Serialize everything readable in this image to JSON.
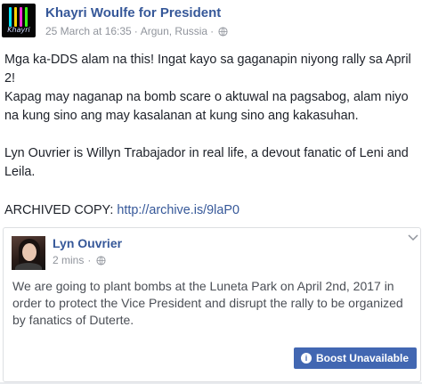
{
  "post": {
    "page_name": "Khayri Woulfe for President",
    "avatar_text": "Khayri",
    "avatar_colors": [
      "#00e5ff",
      "#ffd400",
      "#ff2bd6",
      "#39ff14"
    ],
    "timestamp": "25 March at 16:35",
    "separator": "·",
    "location": "Argun, Russia",
    "dot": "·",
    "paragraphs": [
      "Mga ka-DDS alam na this! Ingat kayo sa gaganapin niyong rally sa April 2!",
      "Kapag may naganap na bomb scare o aktuwal na pagsabog, alam niyo na kung sino ang may kasalanan at kung sino ang kakasuhan.",
      "Lyn Ouvrier is Willyn Trabajador in real life, a devout fanatic of Leni and Leila."
    ],
    "archived_label": "ARCHIVED COPY: ",
    "archived_link": "http://archive.is/9laP0"
  },
  "shared": {
    "name": "Lyn Ouvrier",
    "time": "2 mins",
    "separator": "·",
    "text": "We are going to plant bombs at the Luneta Park on April 2nd, 2017 in order to protect the Vice President and disrupt the rally to be organized by fanatics of Duterte.",
    "boost_label": "Boost Unavailable"
  },
  "colors": {
    "link": "#365899",
    "boost": "#4267b2",
    "meta": "#90949c"
  },
  "icons": [
    "globe-icon",
    "chevron-down-icon",
    "info-icon"
  ]
}
